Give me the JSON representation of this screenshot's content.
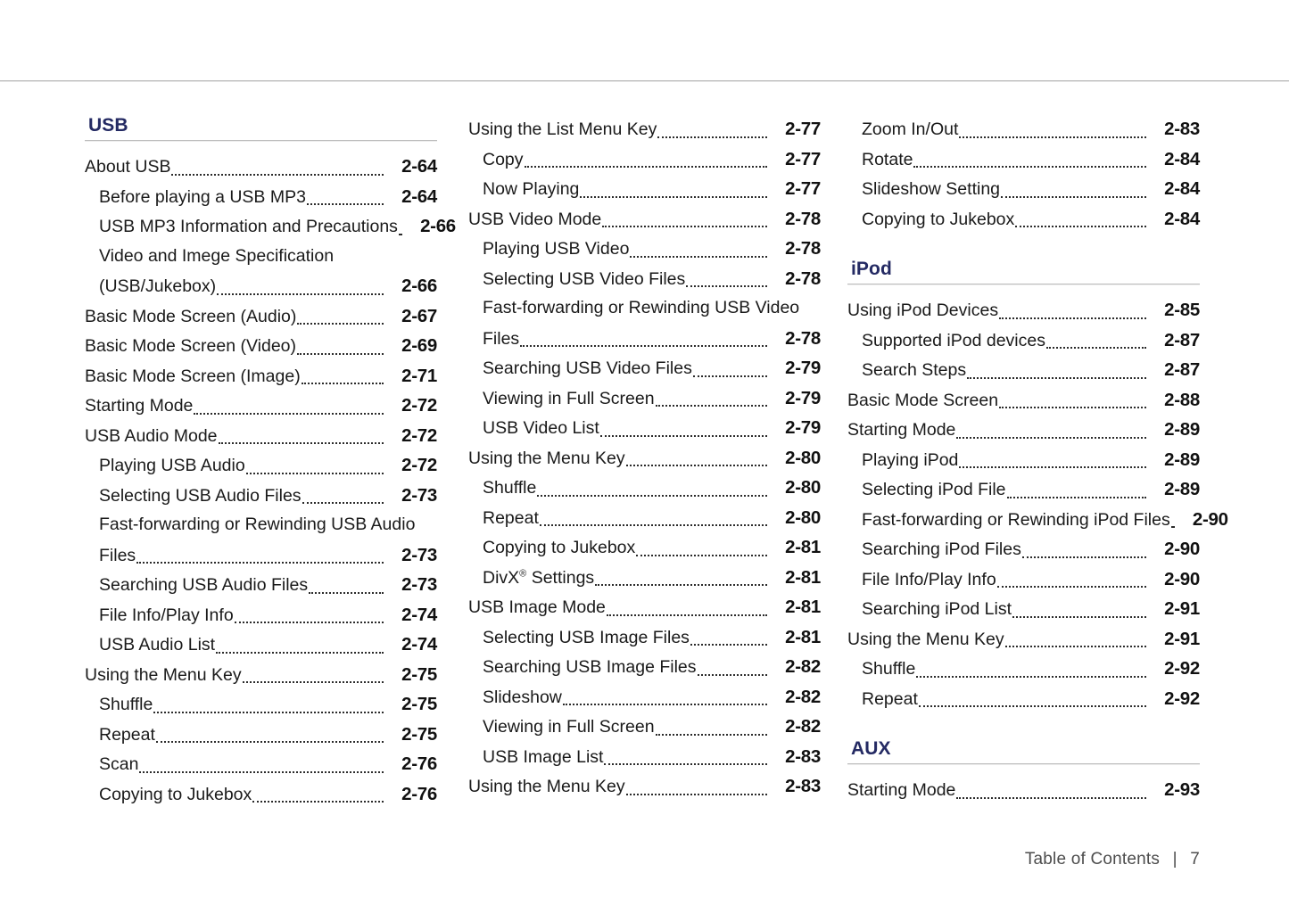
{
  "page": {
    "footer_label": "Table of Contents",
    "footer_separator": "|",
    "footer_page_number": "7",
    "heading_color": "#242a63",
    "rule_color": "#bdbdbd"
  },
  "columns": [
    {
      "sections": [
        {
          "heading": "USB",
          "entries": [
            {
              "label": "About USB",
              "page": "2-64",
              "level": 1
            },
            {
              "label": "Before playing a USB MP3",
              "page": "2-64",
              "level": 2
            },
            {
              "label": "USB MP3 Information and Precautions",
              "page": "2-66",
              "level": 2
            },
            {
              "label": "Video and Imege Specification",
              "page": "",
              "level": 2,
              "continues": true
            },
            {
              "label": "(USB/Jukebox)",
              "page": "2-66",
              "level": 2
            },
            {
              "label": "Basic Mode Screen (Audio)",
              "page": "2-67",
              "level": 1
            },
            {
              "label": "Basic Mode Screen (Video)",
              "page": "2-69",
              "level": 1
            },
            {
              "label": "Basic Mode Screen (Image)",
              "page": "2-71",
              "level": 1
            },
            {
              "label": "Starting Mode",
              "page": "2-72",
              "level": 1
            },
            {
              "label": "USB Audio Mode",
              "page": "2-72",
              "level": 1
            },
            {
              "label": "Playing USB Audio",
              "page": "2-72",
              "level": 2
            },
            {
              "label": "Selecting USB Audio Files",
              "page": "2-73",
              "level": 2
            },
            {
              "label": "Fast-forwarding or Rewinding USB Audio",
              "page": "",
              "level": 2,
              "continues": true
            },
            {
              "label": "Files",
              "page": "2-73",
              "level": 2
            },
            {
              "label": "Searching USB Audio Files",
              "page": "2-73",
              "level": 2
            },
            {
              "label": "File Info/Play Info",
              "page": "2-74",
              "level": 2
            },
            {
              "label": "USB Audio List",
              "page": "2-74",
              "level": 2
            },
            {
              "label": "Using the Menu Key",
              "page": "2-75",
              "level": 1
            },
            {
              "label": "Shuffle",
              "page": "2-75",
              "level": 2
            },
            {
              "label": "Repeat",
              "page": "2-75",
              "level": 2
            },
            {
              "label": "Scan",
              "page": "2-76",
              "level": 2
            },
            {
              "label": "Copying to Jukebox",
              "page": "2-76",
              "level": 2
            }
          ]
        }
      ]
    },
    {
      "sections": [
        {
          "heading": "",
          "entries": [
            {
              "label": "Using the List Menu Key",
              "page": "2-77",
              "level": 1
            },
            {
              "label": "Copy",
              "page": "2-77",
              "level": 2
            },
            {
              "label": "Now Playing",
              "page": "2-77",
              "level": 2
            },
            {
              "label": "USB Video Mode",
              "page": "2-78",
              "level": 1
            },
            {
              "label": "Playing USB Video",
              "page": "2-78",
              "level": 2
            },
            {
              "label": "Selecting USB Video Files",
              "page": "2-78",
              "level": 2
            },
            {
              "label": "Fast-forwarding or Rewinding USB Video",
              "page": "",
              "level": 2,
              "continues": true
            },
            {
              "label": "Files",
              "page": "2-78",
              "level": 2
            },
            {
              "label": "Searching USB Video Files",
              "page": "2-79",
              "level": 2
            },
            {
              "label": "Viewing in Full Screen",
              "page": "2-79",
              "level": 2
            },
            {
              "label": "USB Video List",
              "page": "2-79",
              "level": 2
            },
            {
              "label": "Using the Menu Key",
              "page": "2-80",
              "level": 1
            },
            {
              "label": "Shuffle",
              "page": "2-80",
              "level": 2
            },
            {
              "label": "Repeat",
              "page": "2-80",
              "level": 2
            },
            {
              "label": "Copying to Jukebox",
              "page": "2-81",
              "level": 2
            },
            {
              "label": "DivX® Settings",
              "page": "2-81",
              "level": 2,
              "has_superscript": true,
              "base": "DivX",
              "sup": "®",
              "tail": " Settings"
            },
            {
              "label": "USB Image Mode",
              "page": "2-81",
              "level": 1
            },
            {
              "label": "Selecting USB Image Files",
              "page": "2-81",
              "level": 2
            },
            {
              "label": "Searching USB Image Files",
              "page": "2-82",
              "level": 2
            },
            {
              "label": "Slideshow",
              "page": "2-82",
              "level": 2
            },
            {
              "label": "Viewing in Full Screen",
              "page": "2-82",
              "level": 2
            },
            {
              "label": "USB Image List",
              "page": "2-83",
              "level": 2
            },
            {
              "label": "Using the Menu Key",
              "page": "2-83",
              "level": 1
            }
          ]
        }
      ]
    },
    {
      "sections": [
        {
          "heading": "",
          "entries": [
            {
              "label": "Zoom In/Out",
              "page": "2-83",
              "level": 2
            },
            {
              "label": "Rotate",
              "page": "2-84",
              "level": 2
            },
            {
              "label": "Slideshow Setting",
              "page": "2-84",
              "level": 2
            },
            {
              "label": "Copying to Jukebox",
              "page": "2-84",
              "level": 2
            }
          ]
        },
        {
          "heading": "iPod",
          "spaced": true,
          "entries": [
            {
              "label": "Using iPod Devices",
              "page": "2-85",
              "level": 1
            },
            {
              "label": "Supported iPod devices",
              "page": "2-87",
              "level": 2
            },
            {
              "label": "Search Steps",
              "page": "2-87",
              "level": 2
            },
            {
              "label": "Basic Mode Screen",
              "page": "2-88",
              "level": 1
            },
            {
              "label": "Starting Mode",
              "page": "2-89",
              "level": 1
            },
            {
              "label": "Playing iPod",
              "page": "2-89",
              "level": 2
            },
            {
              "label": "Selecting iPod File",
              "page": "2-89",
              "level": 2
            },
            {
              "label": "Fast-forwarding or Rewinding iPod Files",
              "page": "2-90",
              "level": 2
            },
            {
              "label": "Searching iPod Files",
              "page": "2-90",
              "level": 2
            },
            {
              "label": "File Info/Play Info",
              "page": "2-90",
              "level": 2
            },
            {
              "label": "Searching iPod List",
              "page": "2-91",
              "level": 2
            },
            {
              "label": "Using the Menu Key",
              "page": "2-91",
              "level": 1
            },
            {
              "label": "Shuffle",
              "page": "2-92",
              "level": 2
            },
            {
              "label": "Repeat",
              "page": "2-92",
              "level": 2
            }
          ]
        },
        {
          "heading": "AUX",
          "spaced": true,
          "entries": [
            {
              "label": "Starting Mode",
              "page": "2-93",
              "level": 1
            }
          ]
        }
      ]
    }
  ]
}
